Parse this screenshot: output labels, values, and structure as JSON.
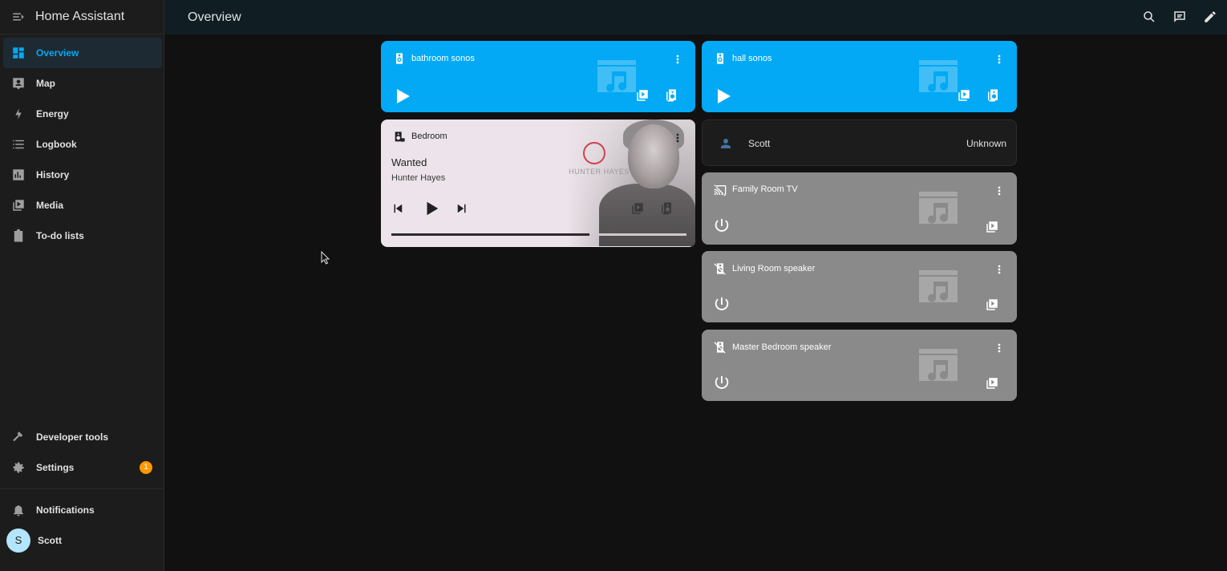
{
  "app": {
    "title": "Home Assistant"
  },
  "sidebar": {
    "items": [
      {
        "label": "Overview",
        "icon": "dashboard-icon",
        "active": true
      },
      {
        "label": "Map",
        "icon": "map-icon"
      },
      {
        "label": "Energy",
        "icon": "lightning-bolt-icon"
      },
      {
        "label": "Logbook",
        "icon": "list-icon"
      },
      {
        "label": "History",
        "icon": "chart-box-icon"
      },
      {
        "label": "Media",
        "icon": "play-box-multiple-icon"
      },
      {
        "label": "To-do lists",
        "icon": "clipboard-list-icon"
      }
    ],
    "bottom": [
      {
        "label": "Developer tools",
        "icon": "hammer-icon"
      },
      {
        "label": "Settings",
        "icon": "cog-icon",
        "badge": "1"
      }
    ],
    "notifications_label": "Notifications",
    "user": {
      "initial": "S",
      "name": "Scott"
    }
  },
  "topbar": {
    "title": "Overview",
    "actions": [
      "search-icon",
      "assist-icon",
      "pencil-icon"
    ]
  },
  "cards": {
    "bathroom": {
      "name": "bathroom sonos",
      "state": "idle",
      "color": "#03a9f4"
    },
    "hall": {
      "name": "hall sonos",
      "state": "idle",
      "color": "#03a9f4"
    },
    "bedroom": {
      "name": "Bedroom",
      "title": "Wanted",
      "artist": "Hunter Hayes",
      "art_text": "HUNTER HAYES",
      "progress": 0.67
    },
    "person": {
      "name": "Scott",
      "state": "Unknown"
    },
    "family_tv": {
      "name": "Family Room TV",
      "state": "off",
      "color": "#8a8a8a"
    },
    "living_speaker": {
      "name": "Living Room speaker",
      "state": "off"
    },
    "master_speaker": {
      "name": "Master Bedroom speaker",
      "state": "off"
    }
  },
  "colors": {
    "accent": "#03a9f4",
    "badge": "#ff9800",
    "sidebar_bg": "#1c1c1c",
    "header_bg": "#101e24",
    "body_bg": "#111111"
  }
}
